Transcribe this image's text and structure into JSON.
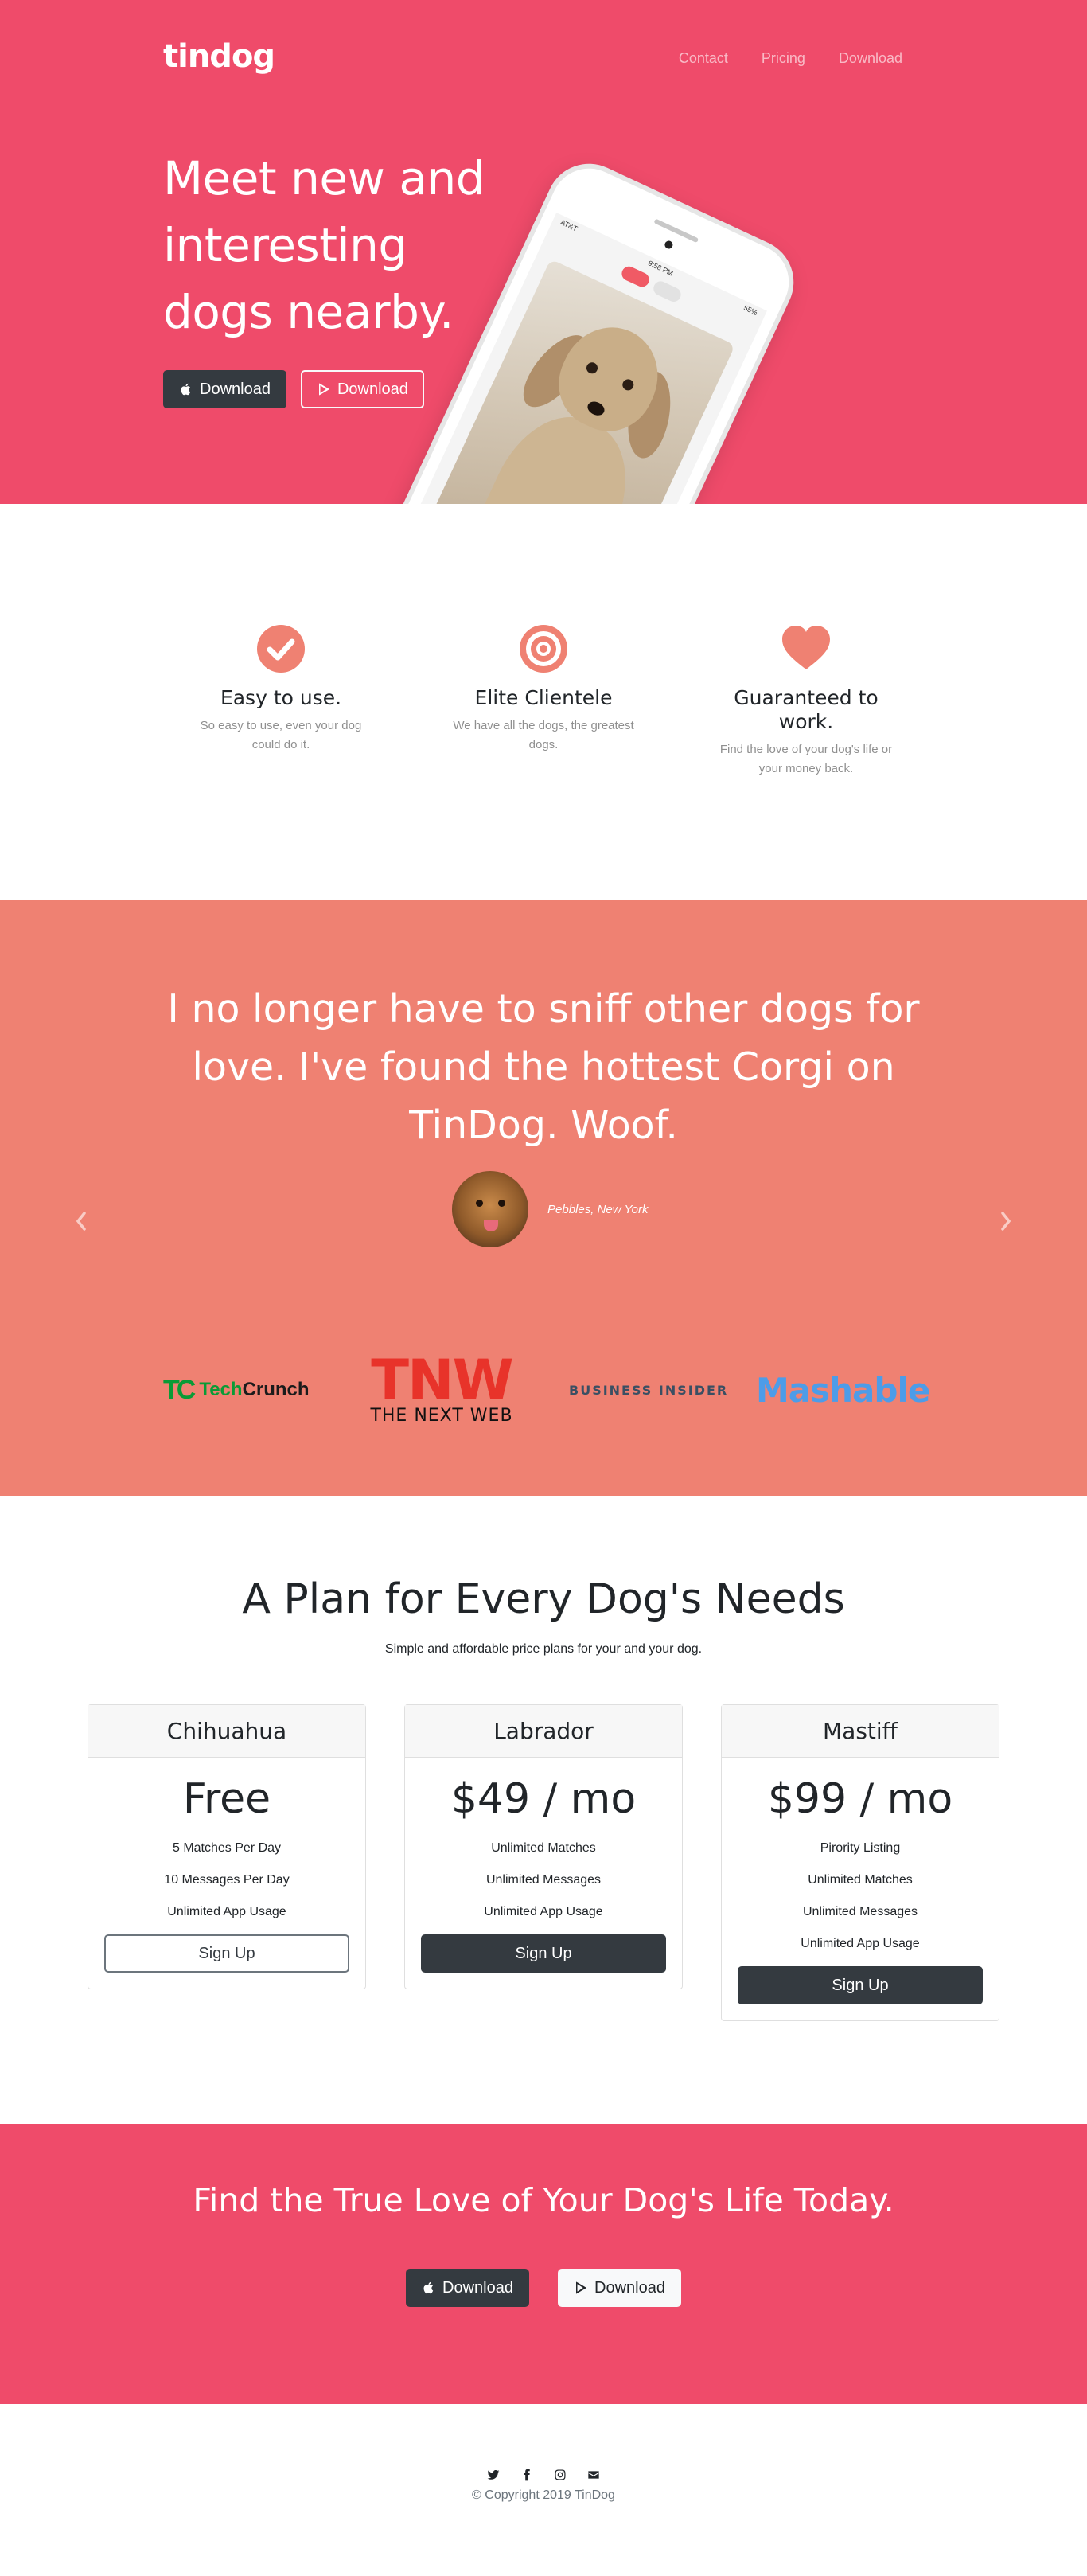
{
  "brand": "tindog",
  "nav": {
    "contact": "Contact",
    "pricing": "Pricing",
    "download": "Download"
  },
  "hero": {
    "title": "Meet new and interesting dogs nearby.",
    "apple_btn": "Download",
    "google_btn": "Download",
    "phone": {
      "carrier": "AT&T",
      "time": "9:58 PM",
      "battery": "55%"
    }
  },
  "features": [
    {
      "icon": "check-circle-icon",
      "title": "Easy to use.",
      "text": "So easy to use, even your dog could do it."
    },
    {
      "icon": "bullseye-icon",
      "title": "Elite Clientele",
      "text": "We have all the dogs, the greatest dogs."
    },
    {
      "icon": "heart-icon",
      "title": "Guaranteed to work.",
      "text": "Find the love of your dog's life or your money back."
    }
  ],
  "testimonial": {
    "quote": "I no longer have to sniff other dogs for love. I've found the hottest Corgi on TinDog. Woof.",
    "caption": "Pebbles, New York"
  },
  "press": {
    "techcrunch_mark": "TC",
    "techcrunch_a": "Tech",
    "techcrunch_b": "Crunch",
    "tnw_big": "TNW",
    "tnw_small": "THE NEXT WEB",
    "business_insider": "BUSINESS INSIDER",
    "mashable": "Mashable"
  },
  "pricing": {
    "title": "A Plan for Every Dog's Needs",
    "subtitle": "Simple and affordable price plans for your and your dog.",
    "plans": [
      {
        "name": "Chihuahua",
        "price": "Free",
        "features": [
          "5 Matches Per Day",
          "10 Messages Per Day",
          "Unlimited App Usage"
        ],
        "button": "Sign Up"
      },
      {
        "name": "Labrador",
        "price": "$49 / mo",
        "features": [
          "Unlimited Matches",
          "Unlimited Messages",
          "Unlimited App Usage"
        ],
        "button": "Sign Up"
      },
      {
        "name": "Mastiff",
        "price": "$99 / mo",
        "features": [
          "Pirority Listing",
          "Unlimited Matches",
          "Unlimited Messages",
          "Unlimited App Usage"
        ],
        "button": "Sign Up"
      }
    ]
  },
  "cta": {
    "title": "Find the True Love of Your Dog's Life Today.",
    "apple_btn": "Download",
    "google_btn": "Download"
  },
  "footer": {
    "social": [
      "twitter-icon",
      "facebook-icon",
      "instagram-icon",
      "envelope-icon"
    ],
    "copyright": "© Copyright 2019 TinDog"
  },
  "colors": {
    "primary": "#ef4b6a",
    "secondary": "#ef8172",
    "dark": "#343a40"
  }
}
